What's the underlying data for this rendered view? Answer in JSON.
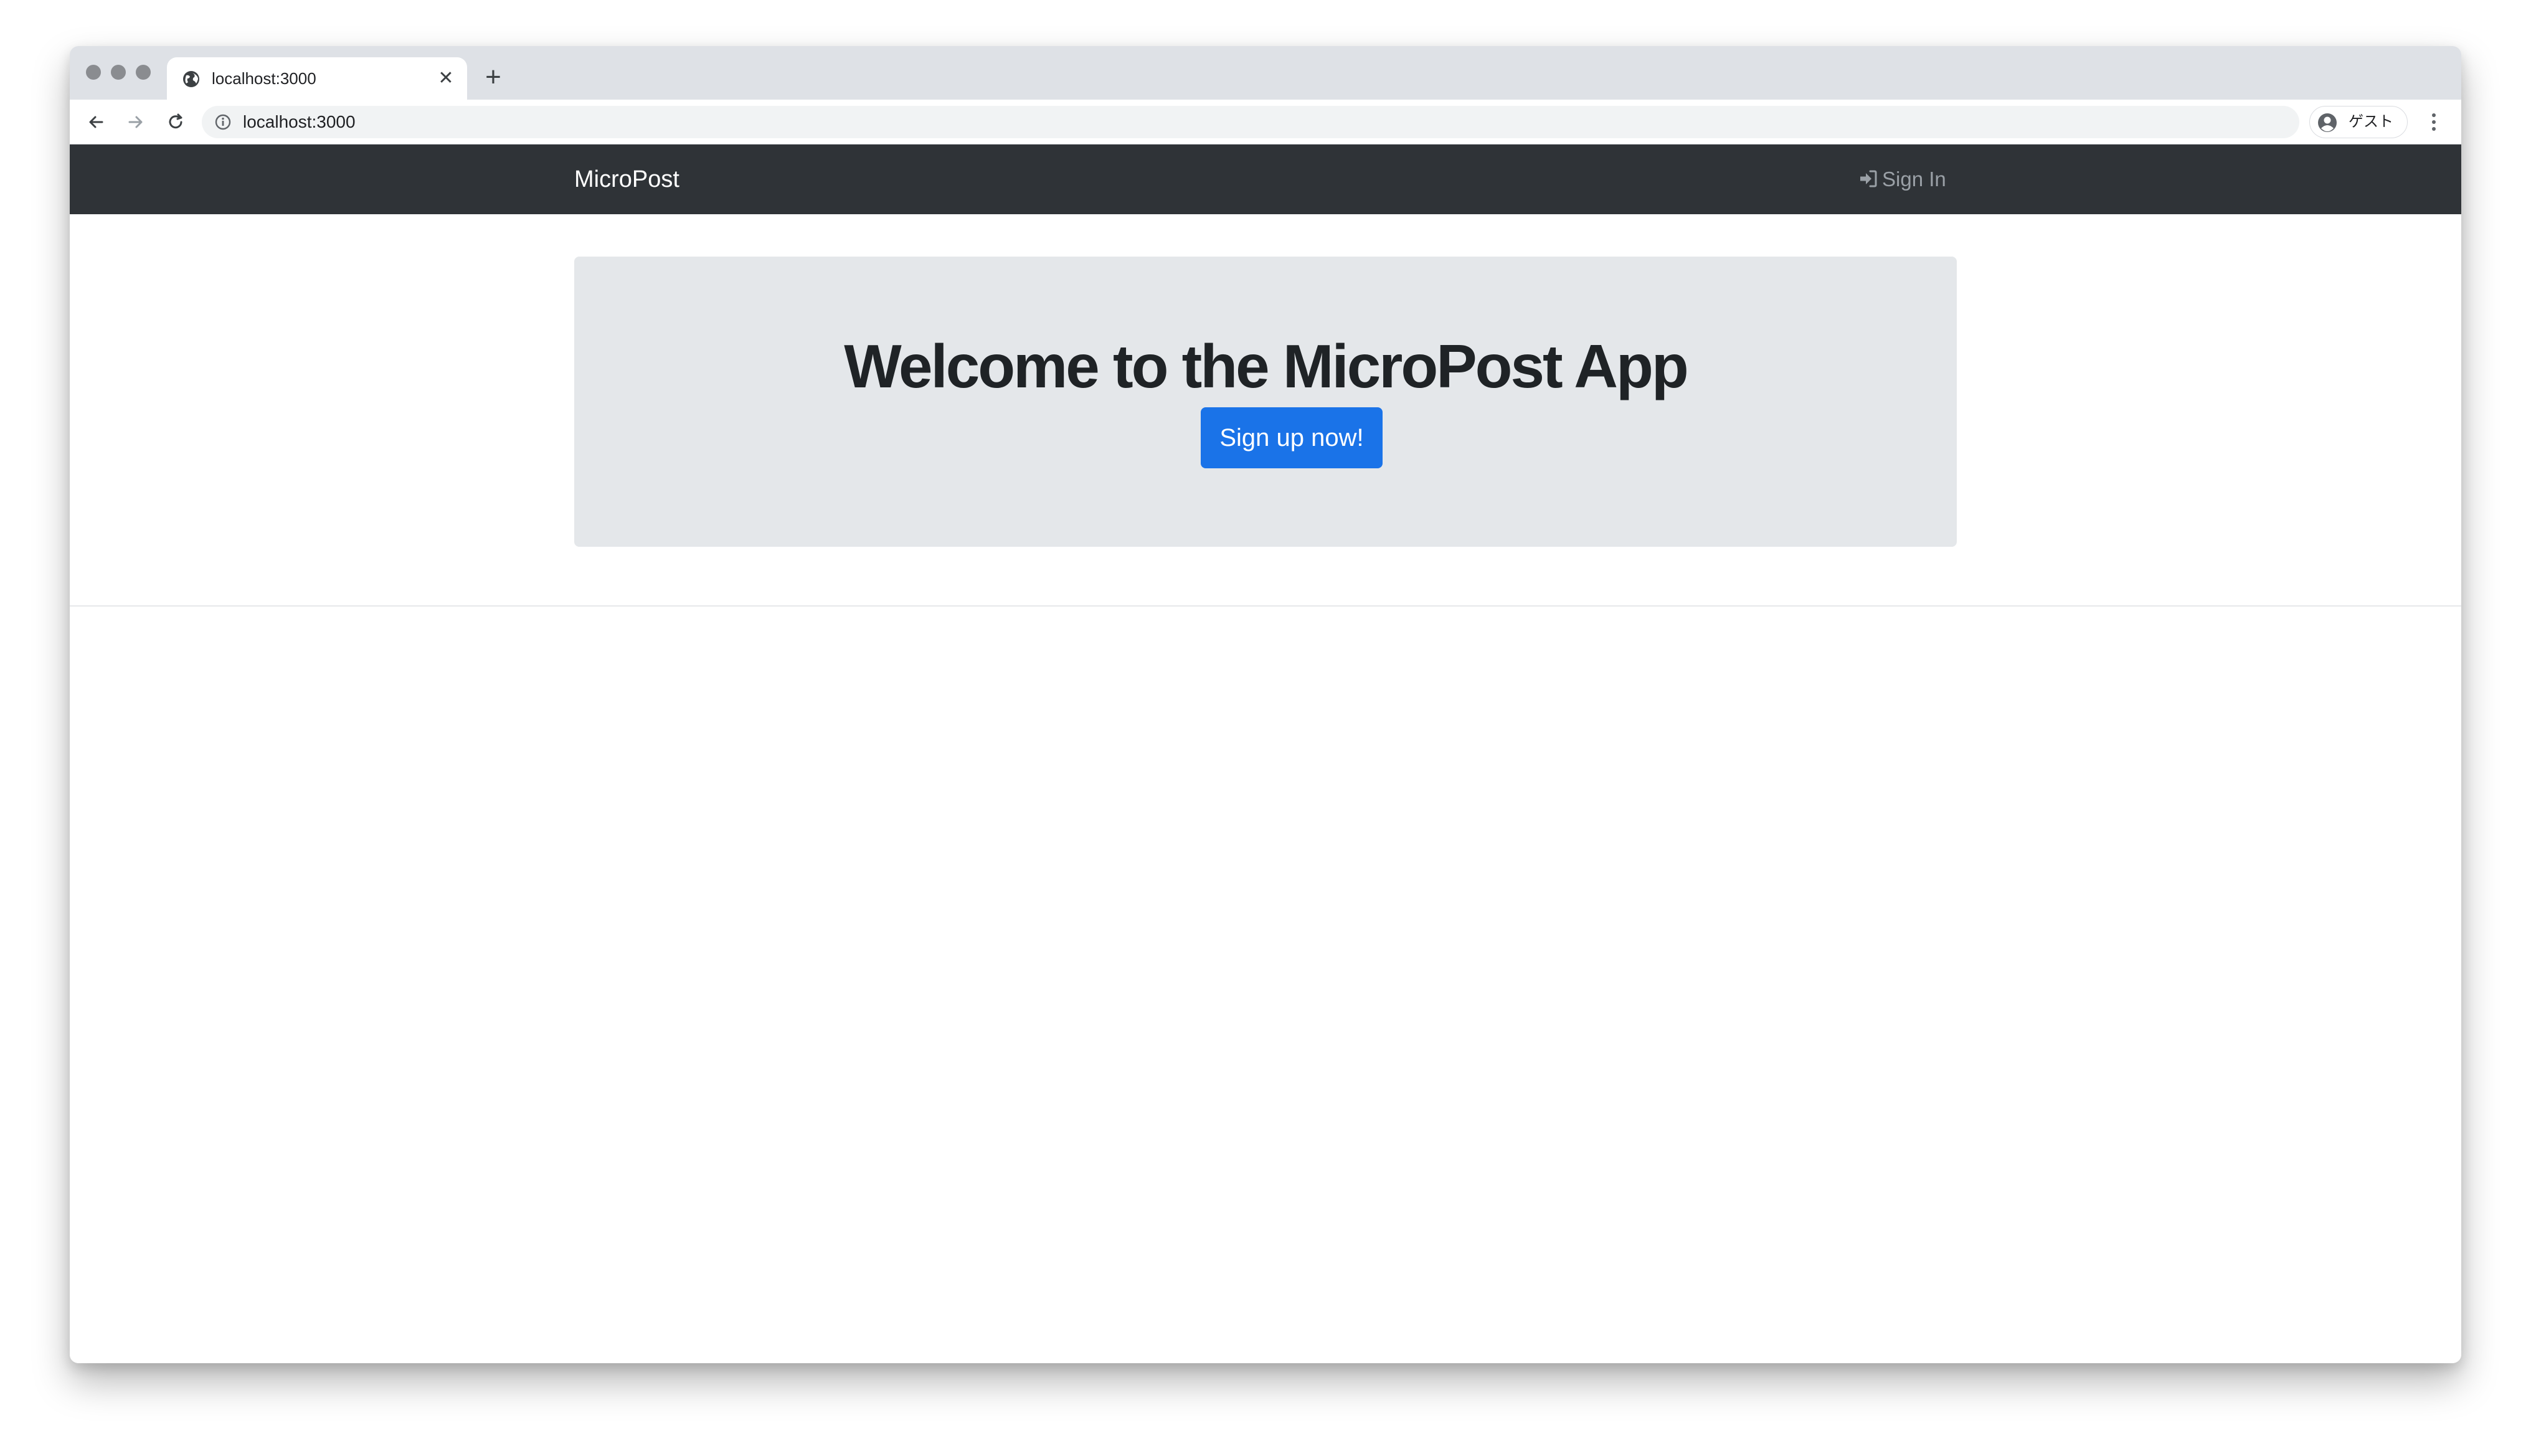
{
  "browser": {
    "tab": {
      "title": "localhost:3000",
      "close_glyph": "✕",
      "favicon": "globe-icon"
    },
    "new_tab_glyph": "+",
    "address_bar": {
      "url": "localhost:3000",
      "info_icon": "info-icon"
    },
    "profile": {
      "label": "ゲスト",
      "icon": "account-circle-icon"
    },
    "nav_icons": [
      "arrow-left-icon",
      "arrow-right-icon",
      "reload-icon"
    ]
  },
  "app": {
    "brand": "MicroPost",
    "nav": {
      "signin_label": "Sign In",
      "signin_icon": "sign-in-icon"
    },
    "hero": {
      "title": "Welcome to the MicroPost App",
      "cta_label": "Sign up now!"
    }
  },
  "colors": {
    "navbar_bg": "#2f3337",
    "jumbotron_bg": "#e4e7ea",
    "primary_button": "#1a73e8",
    "browser_chrome": "#dee1e6"
  }
}
